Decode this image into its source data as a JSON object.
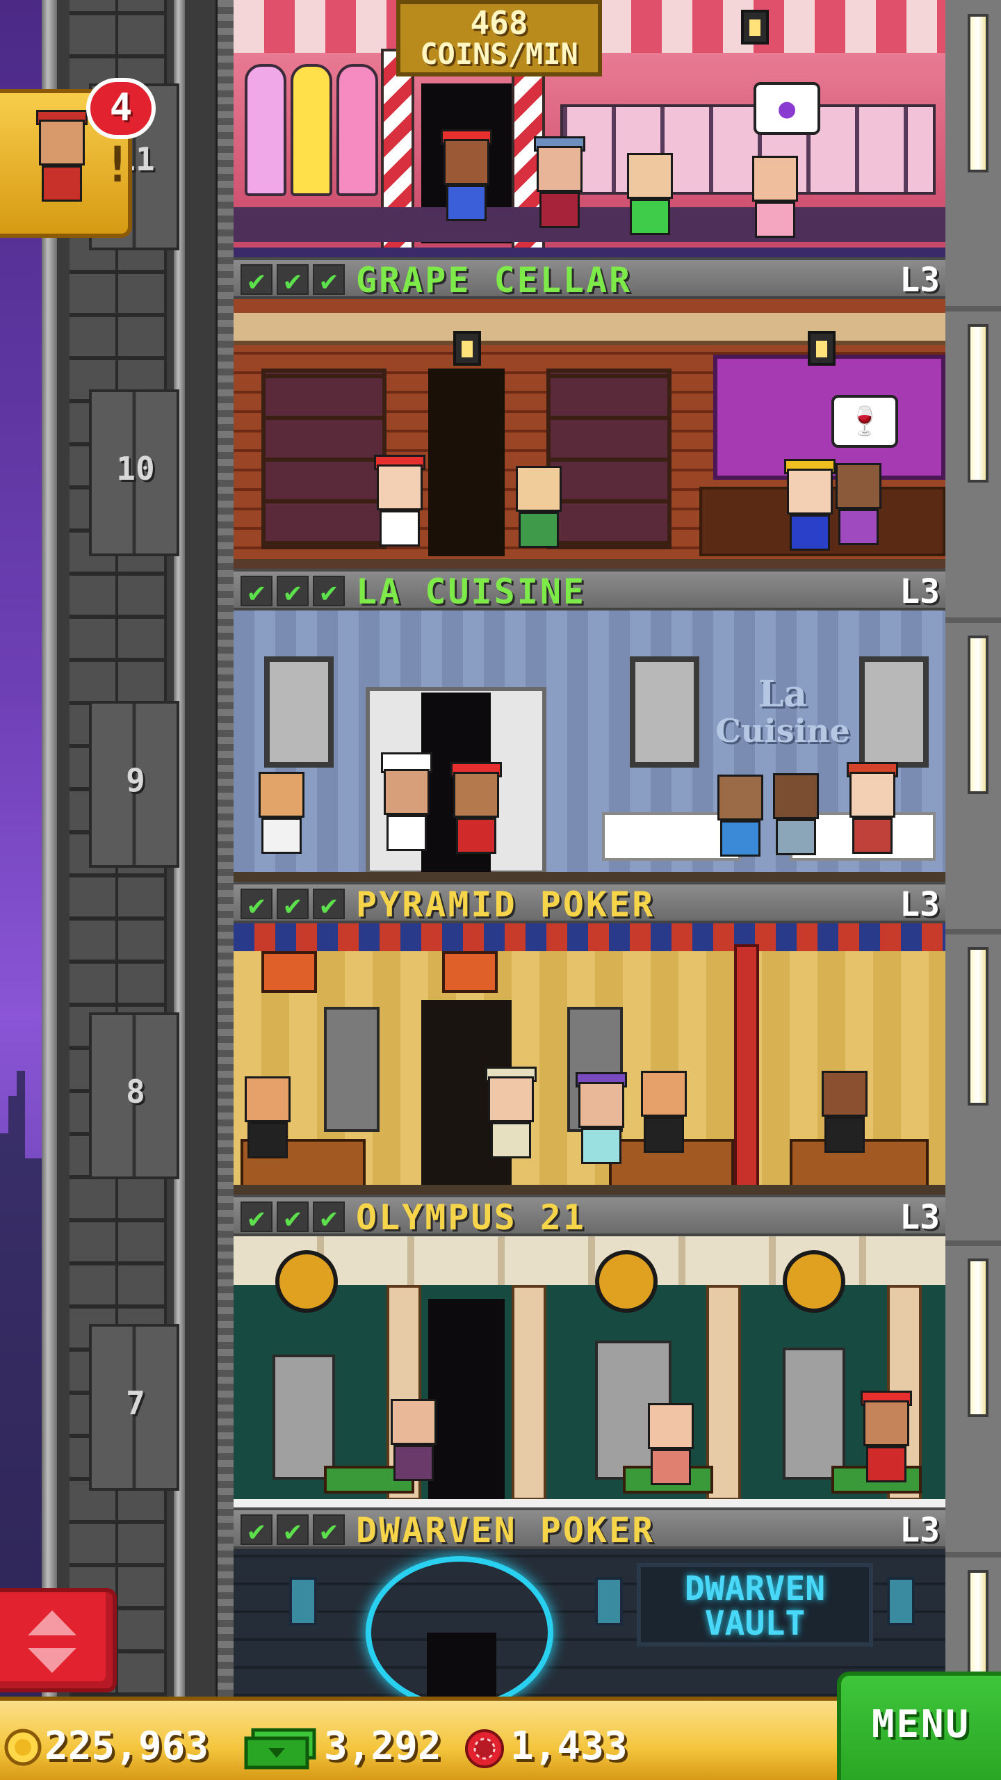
{
  "header": {
    "coins_per_min_value": "468",
    "coins_per_min_unit": "COINS/MIN"
  },
  "bellhop": {
    "notification_count": "4",
    "alert_symbol": "!"
  },
  "elevator": {
    "floor_numbers": [
      "11",
      "10",
      "9",
      "8",
      "7"
    ]
  },
  "floors": [
    {
      "name": "GRAPE CELLAR",
      "level": "L3",
      "checks": [
        "✔",
        "✔",
        "✔"
      ],
      "thought": "🍷",
      "name_color": "#7dea4a"
    },
    {
      "name": "LA CUISINE",
      "level": "L3",
      "checks": [
        "✔",
        "✔",
        "✔"
      ],
      "sign_line1": "La",
      "sign_line2": "Cuisine",
      "name_color": "#7dea4a"
    },
    {
      "name": "PYRAMID POKER",
      "level": "L3",
      "checks": [
        "✔",
        "✔",
        "✔"
      ],
      "name_color": "#f7d54a"
    },
    {
      "name": "OLYMPUS 21",
      "level": "L3",
      "checks": [
        "✔",
        "✔",
        "✔"
      ],
      "name_color": "#f7d54a"
    },
    {
      "name": "DWARVEN POKER",
      "level": "L3",
      "checks": [
        "✔",
        "✔",
        "✔"
      ],
      "sign_line1": "DWARVEN",
      "sign_line2": "VAULT",
      "name_color": "#f7d54a"
    }
  ],
  "stats": {
    "coins": "225,963",
    "bux": "3,292",
    "tokens": "1,433"
  },
  "menu_button": "MENU",
  "colors": {
    "green_label": "#7dea4a",
    "yellow_label": "#f7d54a",
    "menu_green": "#2aa625",
    "badge_red": "#e2232f",
    "gold_bar": "#f4c53d"
  }
}
